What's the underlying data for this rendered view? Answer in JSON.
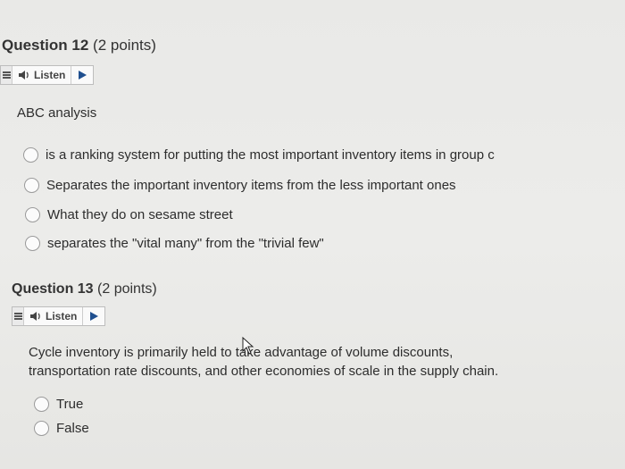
{
  "questions": [
    {
      "title": "Question 12",
      "points": "(2 points)",
      "listen_label": "Listen",
      "prompt": "ABC analysis",
      "options": [
        "is a ranking system for putting the most important inventory items in group c",
        "Separates the important inventory items from the less important ones",
        "What they do on sesame street",
        "separates the \"vital many\" from the \"trivial few\""
      ]
    },
    {
      "title": "Question 13",
      "points": "(2 points)",
      "listen_label": "Listen",
      "prompt_lines": [
        "Cycle inventory is primarily held to take advantage of volume discounts,",
        "transportation rate discounts, and other economies of scale in the supply chain."
      ],
      "options": [
        "True",
        "False"
      ]
    }
  ],
  "icons": {
    "menu": "menu-icon",
    "speaker": "speaker-icon",
    "play": "play-icon",
    "cursor": "mouse-cursor-icon"
  },
  "colors": {
    "background": "#e9e9e7",
    "text": "#2d2d2d",
    "radio_border": "#9a9a9a",
    "play": "#1f4f8f"
  }
}
